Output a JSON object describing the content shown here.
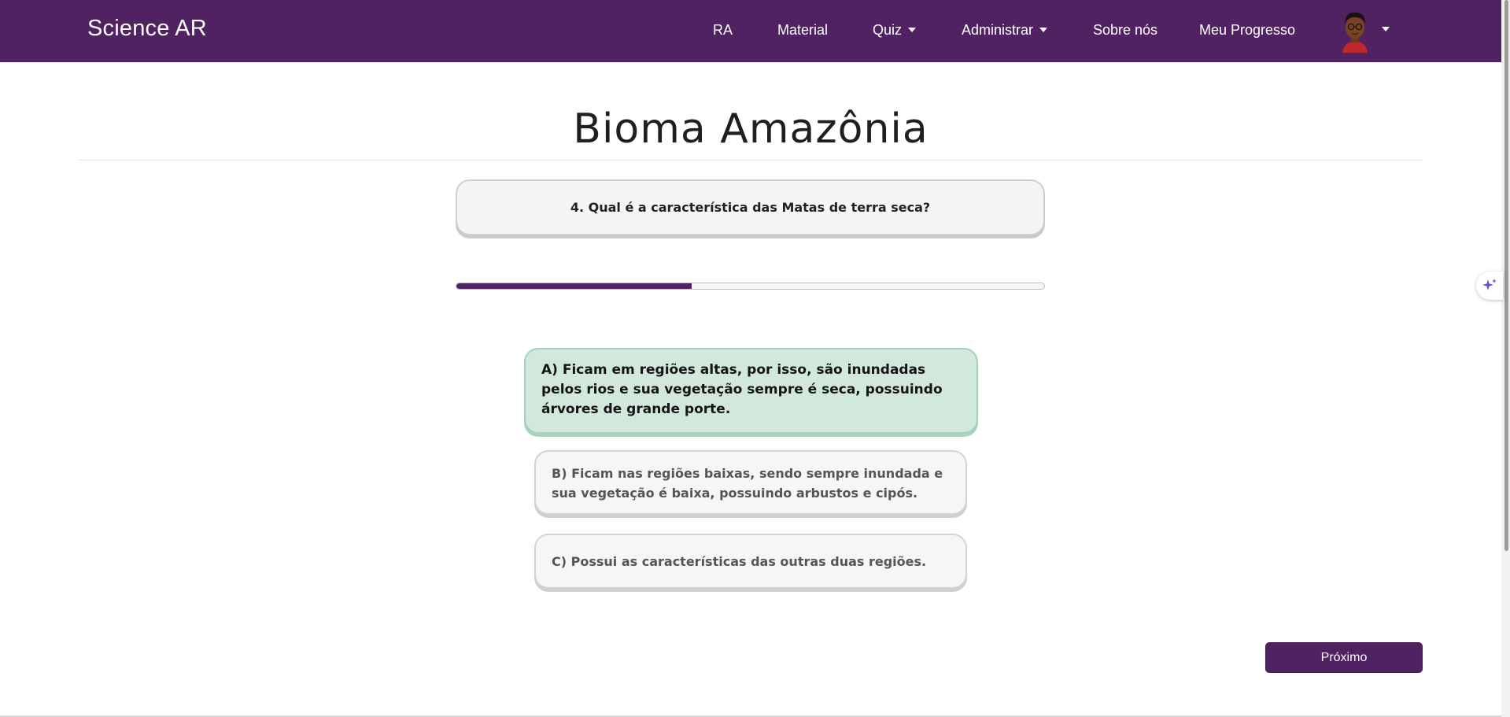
{
  "navbar": {
    "brand": "Science AR",
    "items": [
      {
        "label": "RA",
        "dropdown": false
      },
      {
        "label": "Material",
        "dropdown": false
      },
      {
        "label": "Quiz",
        "dropdown": true
      },
      {
        "label": "Administrar",
        "dropdown": true
      },
      {
        "label": "Sobre nós",
        "dropdown": false
      },
      {
        "label": "Meu Progresso",
        "dropdown": false
      }
    ],
    "avatar_icon": "user-avatar-icon"
  },
  "quiz": {
    "title": "Bioma Amazônia",
    "question": "4. Qual é a característica das Matas de terra seca?",
    "progress": 0.4,
    "options": [
      {
        "text": "A) Ficam em regiões altas, por isso, são inundadas pelos rios e sua vegetação sempre é seca, possuindo árvores de grande porte.",
        "selected": true
      },
      {
        "text": "B) Ficam nas regiões baixas, sendo sempre inundada e sua vegetação é baixa, possuindo arbustos e cipós.",
        "selected": false
      },
      {
        "text": "C) Possui as características das outras duas regiões.",
        "selected": false
      }
    ],
    "next_label": "Próximo"
  },
  "colors": {
    "brand": "#512262",
    "selected_option": "#d3e8dd",
    "option_bg": "#f6f6f6"
  }
}
